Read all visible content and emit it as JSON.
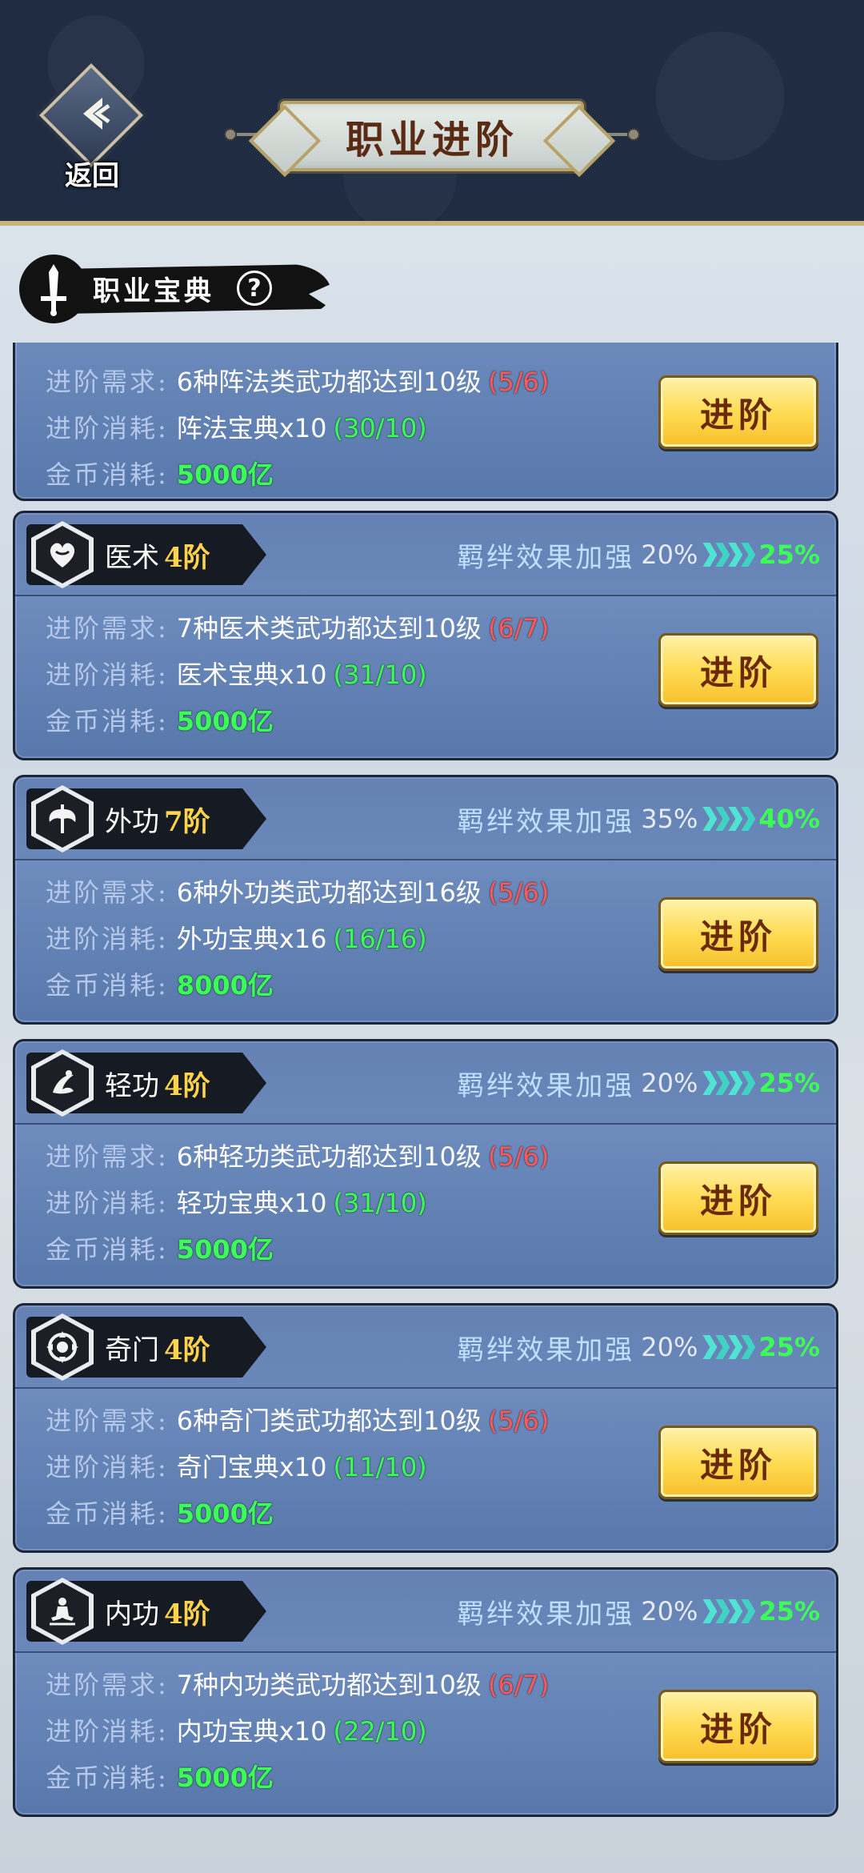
{
  "header": {
    "back_label": "返回",
    "title": "职业进阶"
  },
  "section": {
    "title": "职业宝典",
    "help_symbol": "?"
  },
  "labels": {
    "requirement": "进阶需求:",
    "cost": "进阶消耗:",
    "gold": "金币消耗:",
    "bond": "羁绊效果加强",
    "advance_button": "进阶"
  },
  "top_partial_card": {
    "requirement": "6种阵法类武功都达到10级",
    "requirement_progress": "(5/6)",
    "cost": "阵法宝典x10",
    "cost_progress": "(30/10)",
    "gold": "5000亿"
  },
  "cards": [
    {
      "icon": "heart-icon",
      "name": "医术",
      "level": "4阶",
      "bond_from": "20%",
      "bond_to": "25%",
      "requirement": "7种医术类武功都达到10级",
      "requirement_progress": "(6/7)",
      "cost": "医术宝典x10",
      "cost_progress": "(31/10)",
      "gold": "5000亿"
    },
    {
      "icon": "axe-icon",
      "name": "外功",
      "level": "7阶",
      "bond_from": "35%",
      "bond_to": "40%",
      "requirement": "6种外功类武功都达到16级",
      "requirement_progress": "(5/6)",
      "cost": "外功宝典x16",
      "cost_progress": "(16/16)",
      "gold": "8000亿"
    },
    {
      "icon": "wind-icon",
      "name": "轻功",
      "level": "4阶",
      "bond_from": "20%",
      "bond_to": "25%",
      "requirement": "6种轻功类武功都达到10级",
      "requirement_progress": "(5/6)",
      "cost": "轻功宝典x10",
      "cost_progress": "(31/10)",
      "gold": "5000亿"
    },
    {
      "icon": "compass-icon",
      "name": "奇门",
      "level": "4阶",
      "bond_from": "20%",
      "bond_to": "25%",
      "requirement": "6种奇门类武功都达到10级",
      "requirement_progress": "(5/6)",
      "cost": "奇门宝典x10",
      "cost_progress": "(11/10)",
      "gold": "5000亿"
    },
    {
      "icon": "meditation-icon",
      "name": "内功",
      "level": "4阶",
      "bond_from": "20%",
      "bond_to": "25%",
      "requirement": "7种内功类武功都达到10级",
      "requirement_progress": "(6/7)",
      "cost": "内功宝典x10",
      "cost_progress": "(22/10)",
      "gold": "5000亿"
    }
  ]
}
